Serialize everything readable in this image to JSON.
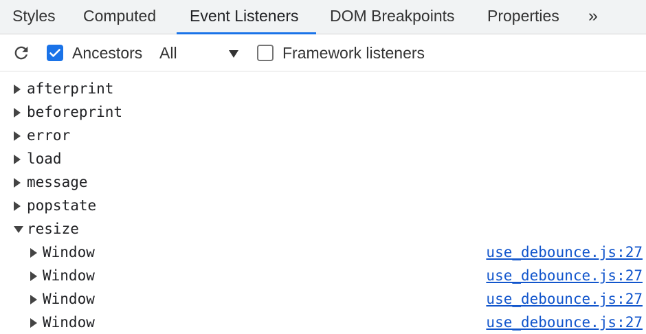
{
  "tabs": [
    {
      "label": "Styles"
    },
    {
      "label": "Computed"
    },
    {
      "label": "Event Listeners"
    },
    {
      "label": "DOM Breakpoints"
    },
    {
      "label": "Properties"
    }
  ],
  "tabs_more_label": "»",
  "active_tab": "Event Listeners",
  "toolbar": {
    "ancestors_label": "Ancestors",
    "ancestors_checked": true,
    "filter_value": "All",
    "framework_label": "Framework listeners",
    "framework_checked": false
  },
  "events": [
    {
      "name": "afterprint",
      "expanded": false
    },
    {
      "name": "beforeprint",
      "expanded": false
    },
    {
      "name": "error",
      "expanded": false
    },
    {
      "name": "load",
      "expanded": false
    },
    {
      "name": "message",
      "expanded": false
    },
    {
      "name": "popstate",
      "expanded": false
    },
    {
      "name": "resize",
      "expanded": true,
      "listeners": [
        {
          "target": "Window",
          "source": "use_debounce.js:27"
        },
        {
          "target": "Window",
          "source": "use_debounce.js:27"
        },
        {
          "target": "Window",
          "source": "use_debounce.js:27"
        },
        {
          "target": "Window",
          "source": "use_debounce.js:27"
        }
      ]
    }
  ],
  "colors": {
    "accent": "#1a73e8",
    "link": "#1155cc"
  }
}
